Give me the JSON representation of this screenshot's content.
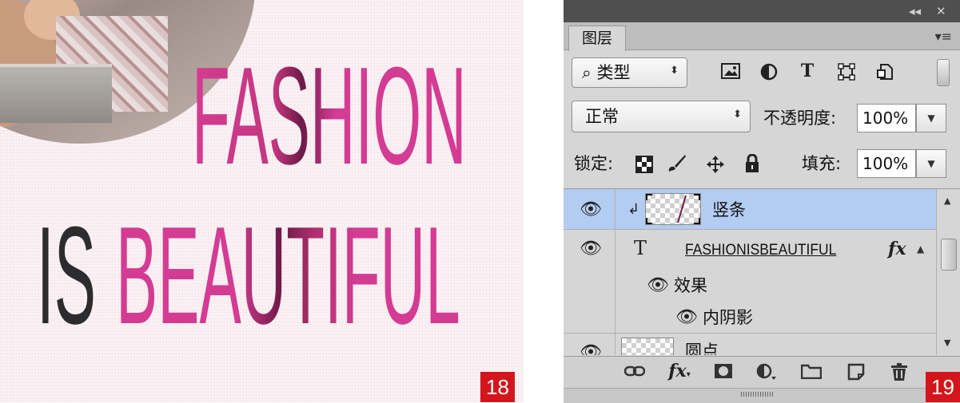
{
  "poster": {
    "line1": "FASHION",
    "line2_left": "IS",
    "line2_right": "BEAUTIFUL",
    "figure_number": "18",
    "colors": {
      "pink": "#d63e93",
      "dark_magenta": "#6d1a47",
      "charcoal": "#2c2c2e",
      "background": "#fbf2f5"
    }
  },
  "panel": {
    "figure_number": "19",
    "title_controls": {
      "collapse": "◂◂",
      "close": "✕"
    },
    "tab_label": "图层",
    "menu_icon": "≡",
    "filter": {
      "label": "类型",
      "search_icon": "⌕"
    },
    "filter_icons": [
      "image-filter-icon",
      "adjustment-filter-icon",
      "type-filter-icon",
      "shape-filter-icon",
      "smart-object-filter-icon"
    ],
    "blend_mode": "正常",
    "opacity_label": "不透明度:",
    "opacity_value": "100%",
    "lock_label": "锁定:",
    "fill_label": "填充:",
    "fill_value": "100%",
    "layers": [
      {
        "name": "竖条",
        "selected": true,
        "clipped": true
      },
      {
        "name": "FASHIONISBEAUTIFUL",
        "type_glyph": "T",
        "fx": "fx"
      },
      {
        "name": "效果"
      },
      {
        "name": "内阴影"
      },
      {
        "name": "圆点"
      }
    ],
    "accent": "#b3ccf2"
  }
}
